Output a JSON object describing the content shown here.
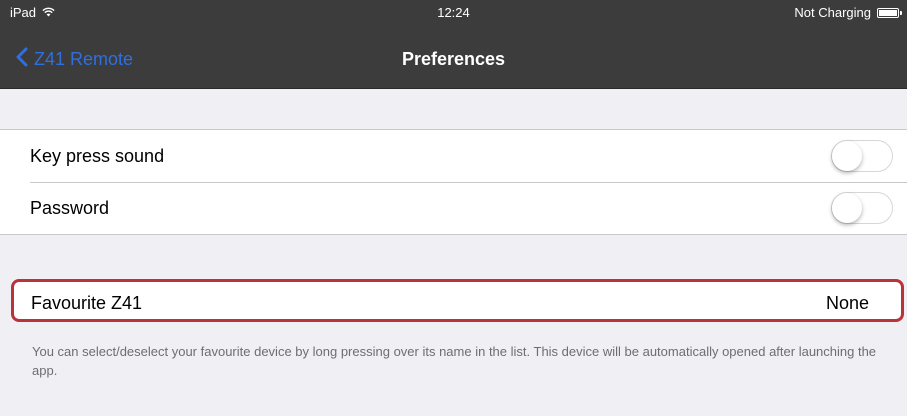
{
  "status_bar": {
    "device": "iPad",
    "time": "12:24",
    "battery_status": "Not Charging"
  },
  "nav": {
    "back_label": "Z41 Remote",
    "title": "Preferences"
  },
  "settings": {
    "key_press_sound": {
      "label": "Key press sound",
      "enabled": false
    },
    "password": {
      "label": "Password",
      "enabled": false
    }
  },
  "favourite": {
    "label": "Favourite Z41",
    "value": "None"
  },
  "footer": {
    "text": "You can select/deselect your favourite device by long pressing over its name in the list. This device will be automatically opened after launching the app."
  },
  "colors": {
    "nav_background": "#3c3c3c",
    "accent": "#2f6fe0",
    "highlight_border": "#b8343a",
    "page_background": "#efeff4"
  },
  "icons": [
    "wifi-icon",
    "battery-icon",
    "back-chevron-icon"
  ]
}
